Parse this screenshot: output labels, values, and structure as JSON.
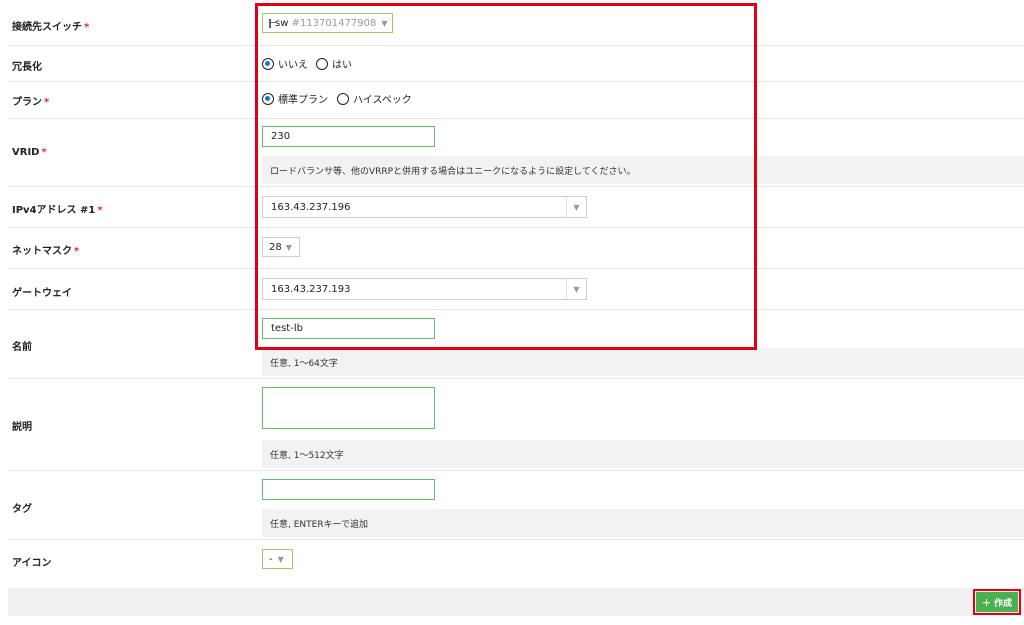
{
  "form": {
    "switch": {
      "label": "接続先スイッチ",
      "req": "*",
      "icon": "switch-icon",
      "name": "sw",
      "id": "#113701477908"
    },
    "redundancy": {
      "label": "冗長化",
      "options": [
        "いいえ",
        "はい"
      ],
      "selected": 0
    },
    "plan": {
      "label": "プラン",
      "req": "*",
      "options": [
        "標準プラン",
        "ハイスペック"
      ],
      "selected": 0
    },
    "vrid": {
      "label": "VRID",
      "req": "*",
      "value": "230",
      "help": "ロードバランサ等、他のVRRPと併用する場合はユニークになるように設定してください。"
    },
    "ipv4": {
      "label": "IPv4アドレス #1",
      "req": "*",
      "value": "163.43.237.196"
    },
    "netmask": {
      "label": "ネットマスク",
      "req": "*",
      "value": "28"
    },
    "gateway": {
      "label": "ゲートウェイ",
      "value": "163.43.237.193"
    },
    "name": {
      "label": "名前",
      "value": "test-lb",
      "help": "任意, 1〜64文字"
    },
    "description": {
      "label": "説明",
      "value": "",
      "help": "任意, 1〜512文字"
    },
    "tag": {
      "label": "タグ",
      "value": "",
      "help": "任意, ENTERキーで追加"
    },
    "icon": {
      "label": "アイコン",
      "value": "-"
    }
  },
  "footer": {
    "create_label": "作成",
    "create_color": "#4caf50"
  },
  "highlight_color": "#e00016"
}
